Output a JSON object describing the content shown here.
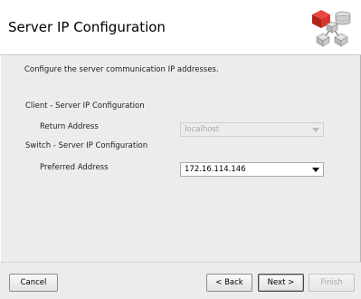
{
  "header": {
    "title": "Server IP Configuration",
    "logo_icon": "network-nodes-logo-icon",
    "logo_colors": {
      "red": "#d9342b",
      "gray": "#9a9a9a"
    }
  },
  "main": {
    "description": "Configure the server communication IP addresses.",
    "client_section": {
      "title": "Client - Server IP Configuration",
      "return_address": {
        "label": "Return Address",
        "value": "localhost",
        "disabled": true
      }
    },
    "switch_section": {
      "title": "Switch - Server IP Configuration",
      "preferred_address": {
        "label": "Preferred Address",
        "value": "172.16.114.146",
        "disabled": false
      }
    }
  },
  "footer": {
    "cancel_label": "Cancel",
    "back_label": "< Back",
    "next_label": "Next >",
    "finish_label": "Finish",
    "finish_disabled": true
  }
}
